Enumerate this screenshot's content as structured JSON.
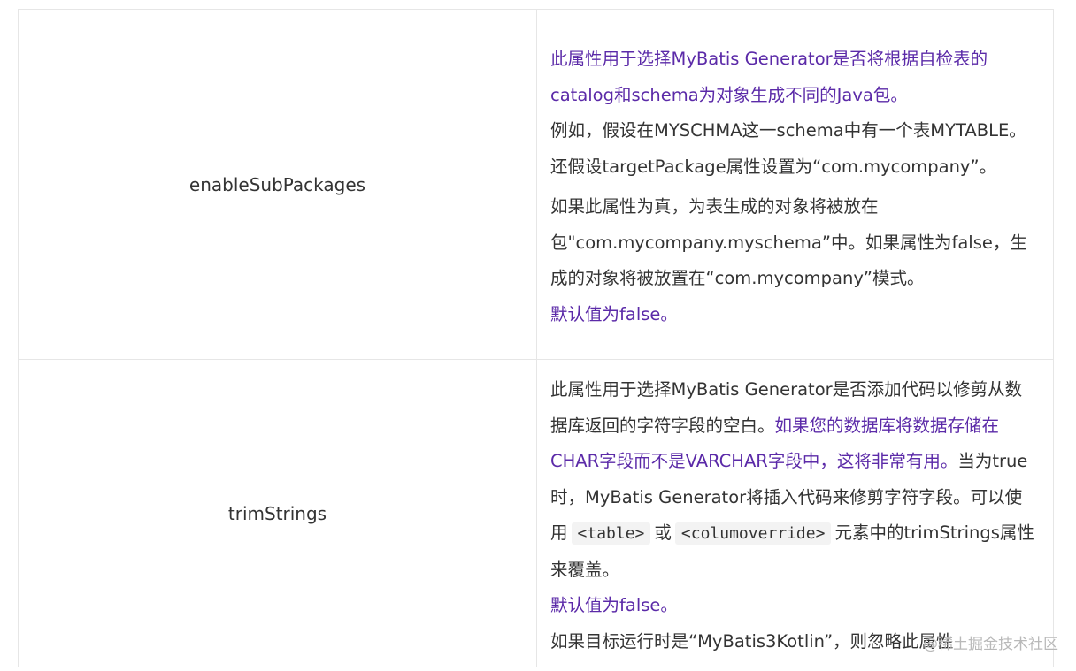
{
  "rows": [
    {
      "name": "enableSubPackages",
      "desc": {
        "p1": {
          "highlight": "此属性用于选择MyBatis Generator是否将根据自检表的catalog和schema为对象生成不同的Java包。",
          "rest": "例如，假设在MYSCHMA这一schema中有一个表MYTABLE。还假设targetPackage属性设置为“com.mycompany”。"
        },
        "p2": "如果此属性为真，为表生成的对象将被放在包\"com.mycompany.myschema”中。如果属性为false，生成的对象将被放置在“com.mycompany”模式。",
        "default": "默认值为false。"
      }
    },
    {
      "name": "trimStrings",
      "desc": {
        "p1_plain": "此属性用于选择MyBatis Generator是否添加代码以修剪从数据库返回的字符字段的空白。",
        "p1_highlight": "如果您的数据库将数据存储在CHAR字段而不是VARCHAR字段中，这将非常有用。",
        "p1_plain2": "当为true时，MyBatis Generator将插入代码来修剪字符字段。可以使用",
        "code1": "<table>",
        "or": "或",
        "code2": "<columoverride>",
        "p1_tail": "元素中的trimStrings属性来覆盖。",
        "default": "默认值为false。",
        "note": "如果目标运行时是“MyBatis3Kotlin”，则忽略此属性"
      }
    }
  ],
  "watermark": {
    "text": "@稀土掘金技术社区"
  },
  "colors": {
    "highlight": "#5b2aa8",
    "text": "#333333",
    "border": "#e6e6e6",
    "code_bg": "#f3f3f3"
  }
}
